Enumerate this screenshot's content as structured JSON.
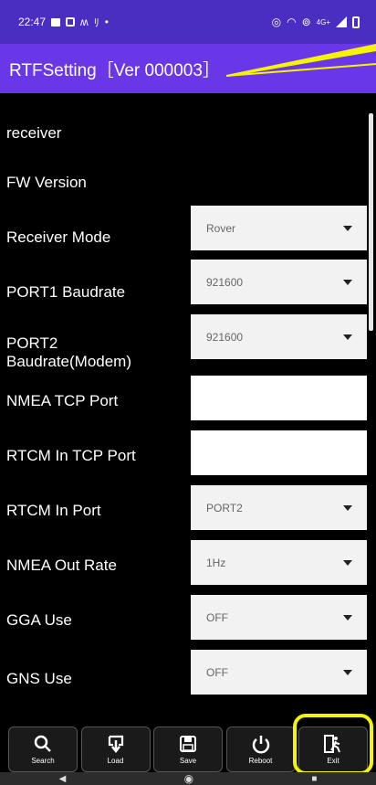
{
  "status_bar": {
    "time": "22:47",
    "network": "4G+"
  },
  "app_bar": {
    "title": "RTFSetting［Ver 000003］"
  },
  "settings": [
    {
      "label": "receiver",
      "type": "text"
    },
    {
      "label": "FW Version",
      "type": "text"
    },
    {
      "label": "Receiver Mode",
      "type": "dropdown",
      "value": "Rover"
    },
    {
      "label": "PORT1 Baudrate",
      "type": "dropdown",
      "value": "921600"
    },
    {
      "label": "PORT2 Baudrate(Modem)",
      "type": "dropdown",
      "value": "921600"
    },
    {
      "label": "NMEA TCP Port",
      "type": "input",
      "value": ""
    },
    {
      "label": "RTCM In TCP Port",
      "type": "input",
      "value": ""
    },
    {
      "label": "RTCM In Port",
      "type": "dropdown",
      "value": "PORT2"
    },
    {
      "label": "NMEA Out Rate",
      "type": "dropdown",
      "value": "1Hz"
    },
    {
      "label": "GGA Use",
      "type": "dropdown",
      "value": "OFF"
    },
    {
      "label": "GNS Use",
      "type": "dropdown",
      "value": "OFF"
    }
  ],
  "toolbar": {
    "search": "Search",
    "load": "Load",
    "save": "Save",
    "reboot": "Reboot",
    "exit": "Exit"
  },
  "annotation_color": "#f6f400"
}
